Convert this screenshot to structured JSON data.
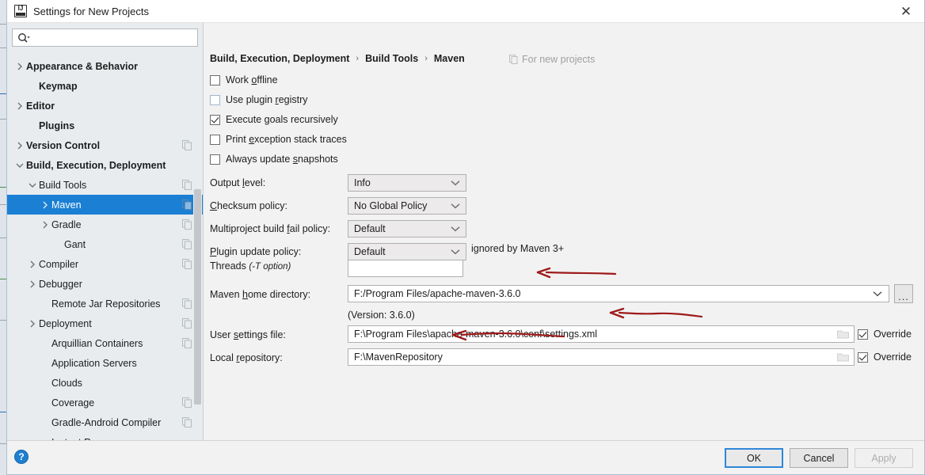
{
  "window": {
    "title": "Settings for New Projects",
    "app_icon": "intellij-idea-icon",
    "close_label": "✕"
  },
  "sidebar": {
    "search": {
      "value": "",
      "placeholder": "",
      "icon": "search-icon"
    },
    "items": [
      {
        "label": "Appearance & Behavior",
        "indent": 0,
        "arrow": "right",
        "bold": true,
        "copy": false,
        "selected": false
      },
      {
        "label": "Keymap",
        "indent": 1,
        "arrow": "none",
        "bold": true,
        "copy": false,
        "selected": false
      },
      {
        "label": "Editor",
        "indent": 0,
        "arrow": "right",
        "bold": true,
        "copy": false,
        "selected": false
      },
      {
        "label": "Plugins",
        "indent": 1,
        "arrow": "none",
        "bold": true,
        "copy": false,
        "selected": false
      },
      {
        "label": "Version Control",
        "indent": 0,
        "arrow": "right",
        "bold": true,
        "copy": true,
        "selected": false
      },
      {
        "label": "Build, Execution, Deployment",
        "indent": 0,
        "arrow": "down",
        "bold": true,
        "copy": false,
        "selected": false
      },
      {
        "label": "Build Tools",
        "indent": 1,
        "arrow": "down",
        "bold": false,
        "copy": true,
        "selected": false
      },
      {
        "label": "Maven",
        "indent": 2,
        "arrow": "right",
        "bold": false,
        "copy": true,
        "selected": true
      },
      {
        "label": "Gradle",
        "indent": 2,
        "arrow": "right",
        "bold": false,
        "copy": true,
        "selected": false
      },
      {
        "label": "Gant",
        "indent": 3,
        "arrow": "none",
        "bold": false,
        "copy": true,
        "selected": false
      },
      {
        "label": "Compiler",
        "indent": 1,
        "arrow": "right",
        "bold": false,
        "copy": true,
        "selected": false
      },
      {
        "label": "Debugger",
        "indent": 1,
        "arrow": "right",
        "bold": false,
        "copy": false,
        "selected": false
      },
      {
        "label": "Remote Jar Repositories",
        "indent": 2,
        "arrow": "none",
        "bold": false,
        "copy": true,
        "selected": false
      },
      {
        "label": "Deployment",
        "indent": 1,
        "arrow": "right",
        "bold": false,
        "copy": true,
        "selected": false
      },
      {
        "label": "Arquillian Containers",
        "indent": 2,
        "arrow": "none",
        "bold": false,
        "copy": true,
        "selected": false
      },
      {
        "label": "Application Servers",
        "indent": 2,
        "arrow": "none",
        "bold": false,
        "copy": false,
        "selected": false
      },
      {
        "label": "Clouds",
        "indent": 2,
        "arrow": "none",
        "bold": false,
        "copy": false,
        "selected": false
      },
      {
        "label": "Coverage",
        "indent": 2,
        "arrow": "none",
        "bold": false,
        "copy": true,
        "selected": false
      },
      {
        "label": "Gradle-Android Compiler",
        "indent": 2,
        "arrow": "none",
        "bold": false,
        "copy": true,
        "selected": false
      },
      {
        "label": "Instant Run",
        "indent": 2,
        "arrow": "none",
        "bold": false,
        "copy": false,
        "selected": false
      }
    ]
  },
  "content": {
    "breadcrumb": [
      "Build, Execution, Deployment",
      "Build Tools",
      "Maven"
    ],
    "breadcrumb_separator": "›",
    "for_new_projects": "For new projects",
    "checkboxes": [
      {
        "label_pre": "Work ",
        "mnemonic": "o",
        "label_post": "ffline",
        "checked": false,
        "light": false
      },
      {
        "label_pre": "Use plugin ",
        "mnemonic": "r",
        "label_post": "egistry",
        "checked": false,
        "light": true
      },
      {
        "label_pre": "Execute ",
        "mnemonic": "g",
        "label_post": "oals recursively",
        "checked": true,
        "light": false
      },
      {
        "label_pre": "Print ",
        "mnemonic": "e",
        "label_post": "xception stack traces",
        "checked": false,
        "light": false
      },
      {
        "label_pre": "Always update ",
        "mnemonic": "s",
        "label_post": "napshots",
        "checked": false,
        "light": false
      }
    ],
    "combos": [
      {
        "label_pre": "Output ",
        "mnemonic": "l",
        "label_post": "evel:",
        "value": "Info"
      },
      {
        "label_pre": "",
        "mnemonic": "C",
        "label_post": "hecksum policy:",
        "value": "No Global Policy"
      },
      {
        "label_pre": "Multiproject build ",
        "mnemonic": "f",
        "label_post": "ail policy:",
        "value": "Default"
      },
      {
        "label_pre": "",
        "mnemonic": "P",
        "label_post": "lugin update policy:",
        "value": "Default"
      }
    ],
    "plugin_policy_note": "ignored by Maven 3+",
    "threads": {
      "label_pre": "Threads ",
      "label_italic": "(-T option)",
      "value": "",
      "placeholder": ""
    },
    "maven_home": {
      "label_pre": "Maven ",
      "mnemonic": "h",
      "label_post": "ome directory:",
      "value": "F:/Program Files/apache-maven-3.6.0",
      "browse_label": "...",
      "version_note": "(Version: 3.6.0)"
    },
    "user_settings": {
      "label_pre": "User ",
      "mnemonic": "s",
      "label_post": "ettings file:",
      "value": "F:\\Program Files\\apache-maven-3.6.0\\conf\\settings.xml",
      "override_label": "Override",
      "override_checked": true
    },
    "local_repo": {
      "label_pre": "Local ",
      "mnemonic": "r",
      "label_post": "epository:",
      "value": "F:\\MavenRepository",
      "override_label": "Override",
      "override_checked": true
    }
  },
  "footer": {
    "help_label": "?",
    "ok_label": "OK",
    "cancel_label": "Cancel",
    "apply_label": "Apply"
  },
  "colors": {
    "selection_blue": "#1b7fd4",
    "annotation_red": "#9e1a1a",
    "dialog_bg": "#f2f2f2",
    "sidebar_bg": "#e8ecef"
  }
}
